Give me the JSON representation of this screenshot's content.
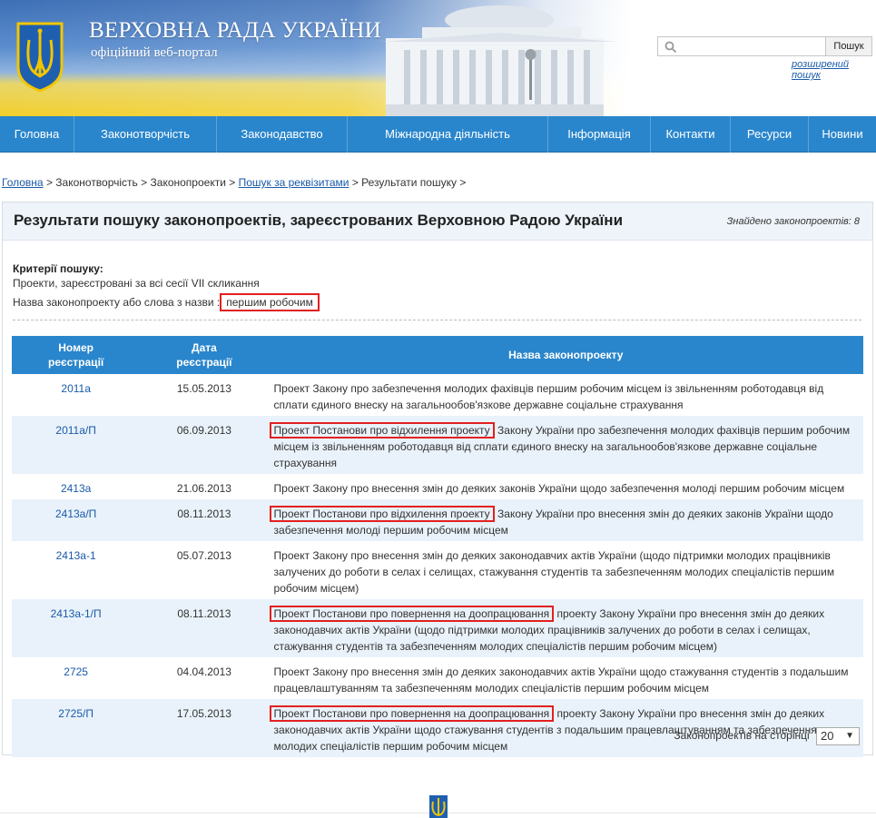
{
  "header": {
    "title": "ВЕРХОВНА РАДА УКРАЇНИ",
    "subtitle": "офіційний веб-портал",
    "search_button": "Пошук",
    "advanced_search": "розширений пошук"
  },
  "nav": [
    "Головна",
    "Законотворчість",
    "Законодавство",
    "Міжнародна діяльність",
    "Інформація",
    "Контакти",
    "Ресурси",
    "Новини"
  ],
  "breadcrumb": {
    "home": "Головна",
    "lawmaking": "Законотворчість",
    "bills": "Законопроекти",
    "search": "Пошук за реквізитами",
    "current": "Результати пошуку",
    "sep": ">"
  },
  "panel": {
    "title": "Результати пошуку законопроектів, зареєстрованих Верховною Радою України",
    "found": "Знайдено законопроектів: 8"
  },
  "criteria": {
    "heading": "Критерії пошуку:",
    "line1": "Проекти, зареєстровані за всі сесії VII скликання",
    "line2_label": "Назва законопроекту або слова з назви :",
    "line2_value": "першим робочим"
  },
  "table": {
    "headers": [
      "Номер реєстрації",
      "Дата реєстрації",
      "Назва законопроекту"
    ],
    "rows": [
      {
        "num": "2011а",
        "date": "15.05.2013",
        "hl": "",
        "text": "Проект Закону про забезпечення молодих фахівців першим робочим місцем із звільненням роботодавця від сплати єдиного внеску на загальнообов'язкове державне соціальне страхування"
      },
      {
        "num": "2011а/П",
        "date": "06.09.2013",
        "hl": "Проект Постанови про відхилення проекту",
        "text": " Закону України про забезпечення молодих фахівців першим робочим місцем із звільненням роботодавця від сплати єдиного внеску на загальнообов'язкове державне соціальне страхування"
      },
      {
        "num": "2413а",
        "date": "21.06.2013",
        "hl": "",
        "text": "Проект Закону про внесення змін до деяких законів України щодо забезпечення молоді першим робочим місцем"
      },
      {
        "num": "2413а/П",
        "date": "08.11.2013",
        "hl": "Проект Постанови про відхилення проекту",
        "text": " Закону України про внесення змін до деяких законів України щодо забезпечення молоді першим робочим місцем"
      },
      {
        "num": "2413а-1",
        "date": "05.07.2013",
        "hl": "",
        "text": "Проект Закону про внесення змін до деяких законодавчих актів України (щодо підтримки молодих працівників залучених до роботи в селах і селищах, стажування студентів та забезпеченням молодих спеціалістів першим робочим місцем)"
      },
      {
        "num": "2413а-1/П",
        "date": "08.11.2013",
        "hl": "Проект Постанови про повернення на доопрацювання",
        "text": " проекту Закону України про внесення змін до деяких законодавчих актів України (щодо підтримки молодих працівників залучених до роботи в селах і селищах, стажування студентів та забезпеченням молодих спеціалістів першим робочим місцем)"
      },
      {
        "num": "2725",
        "date": "04.04.2013",
        "hl": "",
        "text": "Проект Закону про внесення змін до деяких законодавчих актів України щодо стажування студентів з подальшим працевлаштуванням та забезпеченням молодих спеціалістів першим робочим місцем"
      },
      {
        "num": "2725/П",
        "date": "17.05.2013",
        "hl": "Проект Постанови про повернення на доопрацювання",
        "text": " проекту Закону України про внесення змін до деяких законодавчих актів України щодо стажування студентів з подальшим працевлаштуванням та забезпеченням молодих спеціалістів першим робочим місцем"
      }
    ]
  },
  "pagination": {
    "label": "Законопроектів на сторінці",
    "value": "20"
  },
  "colors": {
    "nav_bg": "#2a86cc",
    "link": "#1a5aa8",
    "highlight_border": "#e32020",
    "row_alt": "#e9f2fa"
  }
}
